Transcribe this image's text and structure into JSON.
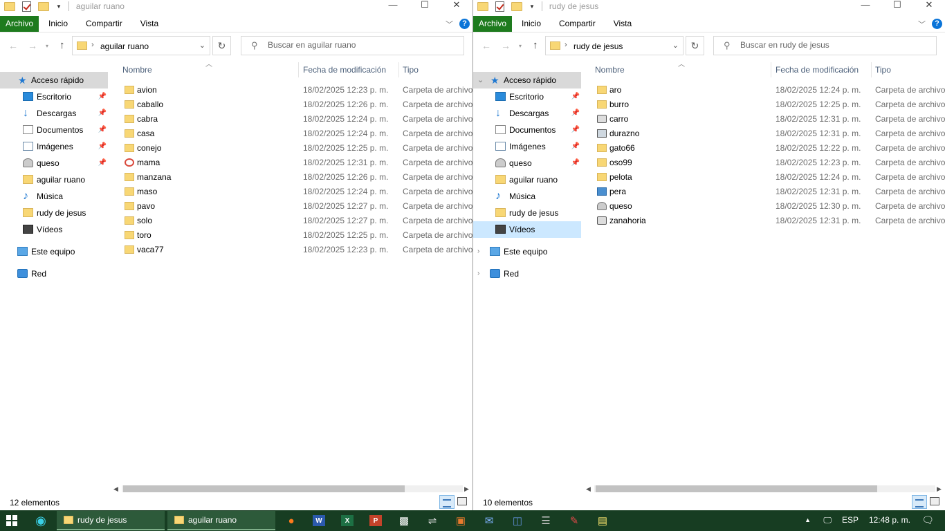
{
  "ribbon": {
    "file_tab": "Archivo",
    "tabs": [
      "Inicio",
      "Compartir",
      "Vista"
    ]
  },
  "nav_pane": {
    "quick_access": "Acceso rápido",
    "items": [
      {
        "label": "Escritorio",
        "icon": "desktop-icon",
        "pinned": true
      },
      {
        "label": "Descargas",
        "icon": "download-icon",
        "pinned": true
      },
      {
        "label": "Documentos",
        "icon": "documents-icon",
        "pinned": true
      },
      {
        "label": "Imágenes",
        "icon": "pictures-icon",
        "pinned": true
      },
      {
        "label": "queso",
        "icon": "drive-icon",
        "pinned": true
      },
      {
        "label": "aguilar ruano",
        "icon": "folder-icon",
        "pinned": false
      },
      {
        "label": "Música",
        "icon": "music-icon",
        "pinned": false
      },
      {
        "label": "rudy de jesus",
        "icon": "folder-icon",
        "pinned": false
      },
      {
        "label": "Vídeos",
        "icon": "videos-icon",
        "pinned": false
      }
    ],
    "this_pc": "Este equipo",
    "network": "Red"
  },
  "columns": {
    "name": "Nombre",
    "date": "Fecha de modificación",
    "type": "Tipo"
  },
  "windows": {
    "left": {
      "title": "aguilar ruano",
      "address": "aguilar ruano",
      "search_placeholder": "Buscar en aguilar ruano",
      "status": "12 elementos",
      "files": [
        {
          "name": "avion",
          "date": "18/02/2025 12:23 p. m.",
          "type": "Carpeta de archivos",
          "icon": "folder"
        },
        {
          "name": "caballo",
          "date": "18/02/2025 12:26 p. m.",
          "type": "Carpeta de archivos",
          "icon": "folder"
        },
        {
          "name": "cabra",
          "date": "18/02/2025 12:24 p. m.",
          "type": "Carpeta de archivos",
          "icon": "folder"
        },
        {
          "name": "casa",
          "date": "18/02/2025 12:24 p. m.",
          "type": "Carpeta de archivos",
          "icon": "folder"
        },
        {
          "name": "conejo",
          "date": "18/02/2025 12:25 p. m.",
          "type": "Carpeta de archivos",
          "icon": "folder"
        },
        {
          "name": "mama",
          "date": "18/02/2025 12:31 p. m.",
          "type": "Carpeta de archivos",
          "icon": "special"
        },
        {
          "name": "manzana",
          "date": "18/02/2025 12:26 p. m.",
          "type": "Carpeta de archivos",
          "icon": "folder"
        },
        {
          "name": "maso",
          "date": "18/02/2025 12:24 p. m.",
          "type": "Carpeta de archivos",
          "icon": "folder"
        },
        {
          "name": "pavo",
          "date": "18/02/2025 12:27 p. m.",
          "type": "Carpeta de archivos",
          "icon": "folder"
        },
        {
          "name": "solo",
          "date": "18/02/2025 12:27 p. m.",
          "type": "Carpeta de archivos",
          "icon": "folder"
        },
        {
          "name": "toro",
          "date": "18/02/2025 12:25 p. m.",
          "type": "Carpeta de archivos",
          "icon": "folder"
        },
        {
          "name": "vaca77",
          "date": "18/02/2025 12:23 p. m.",
          "type": "Carpeta de archivos",
          "icon": "folder"
        }
      ]
    },
    "right": {
      "title": "rudy de jesus",
      "address": "rudy de jesus",
      "search_placeholder": "Buscar en rudy de jesus",
      "status": "10 elementos",
      "files": [
        {
          "name": "aro",
          "date": "18/02/2025 12:24 p. m.",
          "type": "Carpeta de archivos",
          "icon": "folder"
        },
        {
          "name": "burro",
          "date": "18/02/2025 12:25 p. m.",
          "type": "Carpeta de archivos",
          "icon": "folder"
        },
        {
          "name": "carro",
          "date": "18/02/2025 12:31 p. m.",
          "type": "Carpeta de archivos",
          "icon": "drive"
        },
        {
          "name": "durazno",
          "date": "18/02/2025 12:31 p. m.",
          "type": "Carpeta de archivos",
          "icon": "disk"
        },
        {
          "name": "gato66",
          "date": "18/02/2025 12:22 p. m.",
          "type": "Carpeta de archivos",
          "icon": "folder"
        },
        {
          "name": "oso99",
          "date": "18/02/2025 12:23 p. m.",
          "type": "Carpeta de archivos",
          "icon": "folder"
        },
        {
          "name": "pelota",
          "date": "18/02/2025 12:24 p. m.",
          "type": "Carpeta de archivos",
          "icon": "folder"
        },
        {
          "name": "pera",
          "date": "18/02/2025 12:31 p. m.",
          "type": "Carpeta de archivos",
          "icon": "photo"
        },
        {
          "name": "queso",
          "date": "18/02/2025 12:30 p. m.",
          "type": "Carpeta de archivos",
          "icon": "queso"
        },
        {
          "name": "zanahoria",
          "date": "18/02/2025 12:31 p. m.",
          "type": "Carpeta de archivos",
          "icon": "drive"
        }
      ]
    }
  },
  "taskbar": {
    "windows": [
      "rudy de jesus",
      "aguilar ruano"
    ],
    "apps": [
      "firefox-icon",
      "word-icon",
      "excel-icon",
      "powerpoint-icon",
      "pattern-app-icon",
      "settings-app-icon",
      "photo-app-icon",
      "outlook-app-icon",
      "publisher-app-icon",
      "server-app-icon",
      "pen-app-icon",
      "notes-app-icon"
    ],
    "language": "ESP",
    "clock": "12:48 p. m."
  },
  "colors": {
    "file_tab": "#1e7b1e",
    "taskbar": "#173d22",
    "selection": "#cce8ff",
    "quick_access_bg": "#d9d9d9"
  }
}
